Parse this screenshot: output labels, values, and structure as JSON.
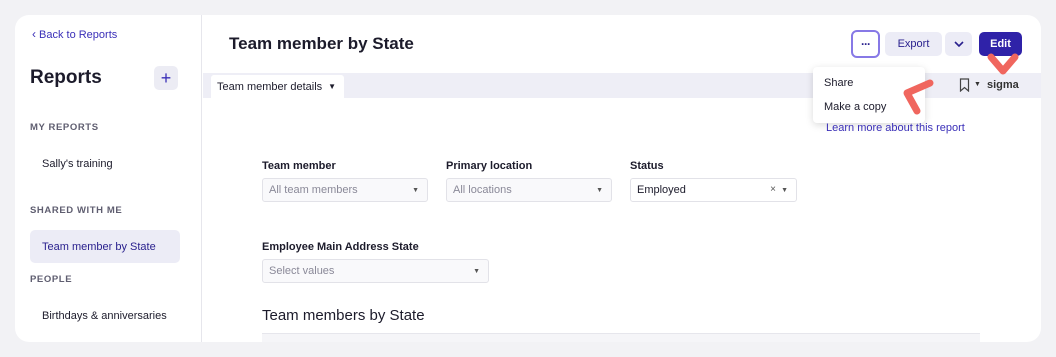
{
  "sidebar": {
    "back_label": "Back to Reports",
    "title": "Reports",
    "add_label": "+",
    "sections": [
      {
        "label": "MY REPORTS",
        "items": [
          {
            "label": "Sally's training"
          }
        ]
      },
      {
        "label": "SHARED WITH ME",
        "items": [
          {
            "label": "Team member by State",
            "active": true
          }
        ]
      },
      {
        "label": "PEOPLE",
        "items": [
          {
            "label": "Birthdays & anniversaries"
          }
        ]
      }
    ]
  },
  "header": {
    "title": "Team member by State",
    "more_label": "···",
    "export_label": "Export",
    "edit_label": "Edit"
  },
  "tabs": [
    {
      "label": "Team member details",
      "active": true
    }
  ],
  "toolbar": {
    "logo_text": "sigma"
  },
  "more_menu": {
    "items": [
      "Share",
      "Make a copy"
    ]
  },
  "learn_more_label": "Learn more about this report",
  "filters": [
    {
      "label": "Team member",
      "value": "",
      "placeholder": "All team members"
    },
    {
      "label": "Primary location",
      "value": "",
      "placeholder": "All locations"
    },
    {
      "label": "Status",
      "value": "Employed",
      "placeholder": ""
    },
    {
      "label": "Employee Main Address State",
      "value": "",
      "placeholder": "Select values"
    }
  ],
  "section_title": "Team members by State",
  "colors": {
    "accent": "#2f22a8",
    "annotation": "#f0665e",
    "focus_ring": "#8779e6"
  },
  "icons": [
    "chevron-left-icon",
    "plus-icon",
    "more-icon",
    "chevron-down-icon",
    "caret-down-icon",
    "bookmark-icon",
    "sigma-logo-icon",
    "clear-icon"
  ]
}
